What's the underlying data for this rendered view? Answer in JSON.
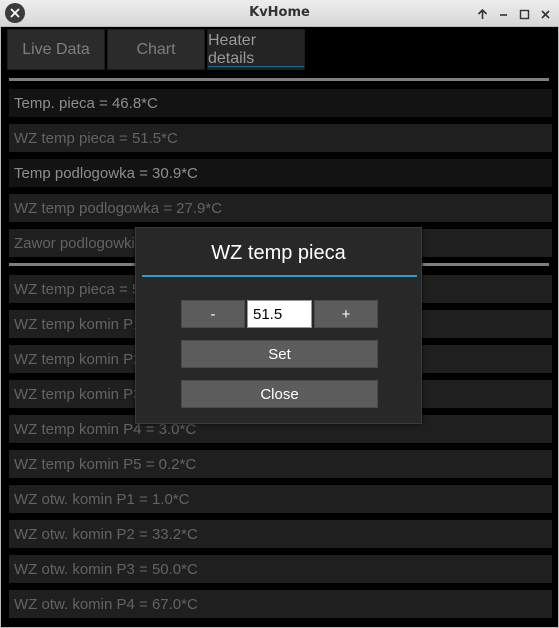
{
  "window": {
    "title": "KvHome"
  },
  "tabs": [
    "Live Data",
    "Chart",
    "Heater details"
  ],
  "list_top": [
    "Temp. pieca = 46.8*C",
    "WZ temp pieca = 51.5*C",
    "Temp podlogowka = 30.9*C",
    "WZ temp podlogowka = 27.9*C",
    "Zawor podlogowki"
  ],
  "list_bottom": [
    "WZ temp pieca = 5",
    "WZ temp komin P1",
    "WZ temp komin P2",
    "WZ temp komin P3",
    "WZ temp komin P4 = 3.0*C",
    "WZ temp komin P5 = 0.2*C",
    "WZ otw. komin P1 = 1.0*C",
    "WZ otw. komin P2 = 33.2*C",
    "WZ otw. komin P3 = 50.0*C",
    "WZ otw. komin P4 = 67.0*C"
  ],
  "popup": {
    "title": "WZ temp pieca",
    "minus_label": "-",
    "value": "51.5",
    "plus_label": "+",
    "set_label": "Set",
    "close_label": "Close"
  }
}
